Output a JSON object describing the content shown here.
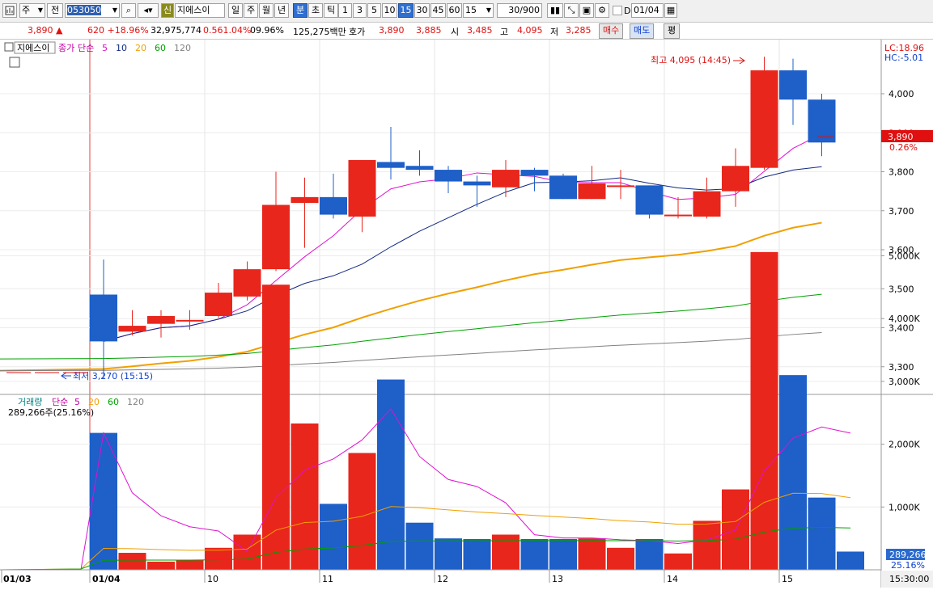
{
  "toolbar": {
    "chart_icon": "chart-icon",
    "market": "주",
    "scope": "전",
    "code": "053050",
    "type_badge": "신",
    "stock_name": "지에스이",
    "period_buttons": [
      "일",
      "주",
      "월",
      "년",
      "분",
      "초",
      "틱"
    ],
    "active_period": "분",
    "minute_buttons": [
      "1",
      "3",
      "5",
      "10",
      "15",
      "30",
      "45",
      "60"
    ],
    "active_minute": "15",
    "minute_select": "15",
    "count": "30/900",
    "date": "01/04",
    "checkbox_label": "D"
  },
  "quote": {
    "price": "3,890",
    "arrow": "▲",
    "change": "620 +18.96%",
    "volume": "32,975,774",
    "volume_ratio": "0.561.04%",
    "turnover": "09.96%",
    "amount": "125,275백만",
    "hoga_label": "호가",
    "hoga_ask": "3,890",
    "hoga_bid": "3,885",
    "open_label": "시",
    "open": "3,485",
    "high_label": "고",
    "high": "4,095",
    "low_label": "저",
    "low": "3,285",
    "buy_button": "매수",
    "sell_button": "매도",
    "avg_button": "평"
  },
  "price_panel": {
    "name_box": "지에스이",
    "legend_prefix": "종가",
    "legend_type": "단순",
    "ma_labels": [
      "5",
      "10",
      "20",
      "60",
      "120"
    ],
    "ma_colors": [
      "#e010d0",
      "#102880",
      "#f0a000",
      "#00a000",
      "#808080"
    ],
    "lc": "LC:18.96",
    "hc": "HC:-5.01",
    "high_annot": "최고 4,095 (14:45)",
    "low_annot": "최저 3,270 (15:15)",
    "last_price_tag": "3,890",
    "last_pct_tag": "0.26%"
  },
  "volume_panel": {
    "legend_prefix": "거래량",
    "legend_type": "단순",
    "ma_labels": [
      "5",
      "20",
      "60",
      "120"
    ],
    "current_value_label": "289,266주(25.16%)",
    "last_tag": "289,266",
    "last_pct": "25.16%"
  },
  "x_axis": {
    "labels": [
      "01/03",
      "01/04",
      "10",
      "11",
      "12",
      "13",
      "14",
      "15"
    ],
    "time_tag": "15:30:00"
  },
  "chart_data": {
    "type": "candlestick",
    "y_ticks": [
      3300,
      3400,
      3500,
      3600,
      3700,
      3800,
      3900,
      4000
    ],
    "y_tick_labels": [
      "3,300",
      "3,400",
      "3,500",
      "3,600",
      "3,700",
      "3,800",
      "3,900",
      "4,000"
    ],
    "vol_ticks": [
      1000,
      2000,
      3000,
      4000,
      5000
    ],
    "vol_tick_labels": [
      "1,000K",
      "2,000K",
      "3,000K",
      "4,000K",
      "5,000K"
    ],
    "candles": [
      {
        "o": 3485,
        "h": 3575,
        "l": 3270,
        "c": 3365
      },
      {
        "o": 3390,
        "h": 3445,
        "l": 3380,
        "c": 3405
      },
      {
        "o": 3410,
        "h": 3445,
        "l": 3375,
        "c": 3430
      },
      {
        "o": 3420,
        "h": 3445,
        "l": 3395,
        "c": 3420
      },
      {
        "o": 3430,
        "h": 3515,
        "l": 3425,
        "c": 3490
      },
      {
        "o": 3480,
        "h": 3570,
        "l": 3470,
        "c": 3550
      },
      {
        "o": 3550,
        "h": 3800,
        "l": 3545,
        "c": 3715
      },
      {
        "o": 3720,
        "h": 3785,
        "l": 3605,
        "c": 3735
      },
      {
        "o": 3735,
        "h": 3795,
        "l": 3680,
        "c": 3690
      },
      {
        "o": 3685,
        "h": 3830,
        "l": 3645,
        "c": 3830
      },
      {
        "o": 3825,
        "h": 3915,
        "l": 3780,
        "c": 3810
      },
      {
        "o": 3815,
        "h": 3855,
        "l": 3790,
        "c": 3805
      },
      {
        "o": 3805,
        "h": 3815,
        "l": 3745,
        "c": 3775
      },
      {
        "o": 3775,
        "h": 3790,
        "l": 3710,
        "c": 3765
      },
      {
        "o": 3760,
        "h": 3830,
        "l": 3735,
        "c": 3805
      },
      {
        "o": 3805,
        "h": 3810,
        "l": 3750,
        "c": 3790
      },
      {
        "o": 3790,
        "h": 3795,
        "l": 3730,
        "c": 3730
      },
      {
        "o": 3730,
        "h": 3815,
        "l": 3730,
        "c": 3770
      },
      {
        "o": 3765,
        "h": 3805,
        "l": 3730,
        "c": 3765
      },
      {
        "o": 3765,
        "h": 3765,
        "l": 3680,
        "c": 3690
      },
      {
        "o": 3690,
        "h": 3735,
        "l": 3680,
        "c": 3690
      },
      {
        "o": 3685,
        "h": 3785,
        "l": 3680,
        "c": 3750
      },
      {
        "o": 3750,
        "h": 3860,
        "l": 3710,
        "c": 3815
      },
      {
        "o": 3810,
        "h": 4095,
        "l": 3805,
        "c": 4060
      },
      {
        "o": 4060,
        "h": 4090,
        "l": 3920,
        "c": 3985
      },
      {
        "o": 3985,
        "h": 4000,
        "l": 3840,
        "c": 3875
      }
    ],
    "volumes_k": [
      2180,
      270,
      130,
      160,
      350,
      560,
      4540,
      2330,
      1050,
      1860,
      3030,
      750,
      500,
      490,
      560,
      490,
      490,
      500,
      350,
      490,
      260,
      780,
      1280,
      5060,
      3100,
      1150,
      290
    ],
    "last_price": 3890,
    "flat_price": 3285
  }
}
